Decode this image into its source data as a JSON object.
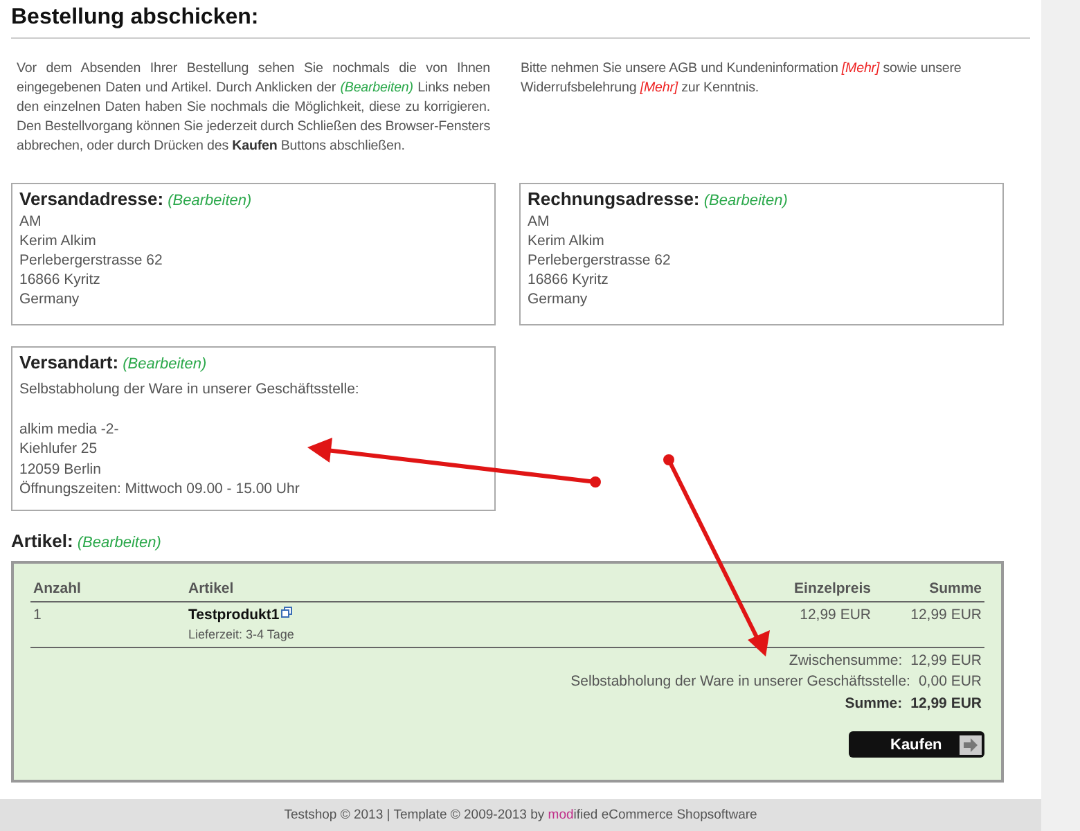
{
  "page_title": "Bestellung abschicken:",
  "intro": [
    {
      "kind": "text",
      "text": "Vor dem Absenden Ihrer Bestellung sehen Sie nochmals die von Ihnen eingegebenen Daten und Artikel. Durch Anklicken der "
    },
    {
      "kind": "link",
      "text": "(Bearbeiten)"
    },
    {
      "kind": "text",
      "text": " Links neben den einzelnen Daten haben Sie nochmals die Möglichkeit, diese zu korrigieren. Den Bestellvorgang können Sie jederzeit durch Schließen des Browser-Fensters abbrechen, oder durch Drücken des "
    },
    {
      "kind": "bold",
      "text": "Kaufen"
    },
    {
      "kind": "text",
      "text": " Buttons abschließen."
    }
  ],
  "terms": [
    {
      "kind": "text",
      "text": "Bitte nehmen Sie unsere AGB und Kundeninformation "
    },
    {
      "kind": "link",
      "text": "[Mehr]"
    },
    {
      "kind": "text",
      "text": " sowie unsere Widerrufsbelehrung "
    },
    {
      "kind": "link",
      "text": "[Mehr]"
    },
    {
      "kind": "text",
      "text": " zur Kenntnis."
    }
  ],
  "addresses": [
    {
      "heading": "Versandadresse:",
      "edit_link": "(Bearbeiten)",
      "lines": [
        "AM",
        "Kerim Alkim",
        "Perlebergerstrasse 62",
        "16866 Kyritz",
        "Germany"
      ]
    },
    {
      "heading": "Rechnungsadresse:",
      "edit_link": "(Bearbeiten)",
      "lines": [
        "AM",
        "Kerim Alkim",
        "Perlebergerstrasse 62",
        "16866 Kyritz",
        "Germany"
      ]
    }
  ],
  "shipping": {
    "heading": "Versandart:",
    "edit_link": "(Bearbeiten)",
    "method": "Selbstabholung der Ware in unserer Geschäftsstelle:",
    "lines": [
      "alkim media -2-",
      "Kiehlufer 25",
      "12059 Berlin",
      "Öffnungszeiten: Mittwoch 09.00 - 15.00 Uhr"
    ]
  },
  "articles": {
    "heading": "Artikel:",
    "edit_link": "(Bearbeiten)",
    "columns": [
      "Anzahl",
      "Artikel",
      "Einzelpreis",
      "Summe"
    ],
    "rows": [
      {
        "qty": "1",
        "name": "Testprodukt1",
        "delivery": "Lieferzeit: 3-4 Tage",
        "unit_price": "12,99 EUR",
        "total": "12,99 EUR"
      }
    ],
    "totals": [
      {
        "label": "Zwischensumme:",
        "value": "12,99 EUR",
        "bold": false
      },
      {
        "label": "Selbstabholung der Ware in unserer Geschäftsstelle:",
        "value": "0,00 EUR",
        "bold": false
      },
      {
        "label": "Summe:",
        "value": "12,99 EUR",
        "bold": true
      }
    ],
    "buy_button": "Kaufen"
  },
  "footer": {
    "text": "Testshop © 2013 | Template © 2009-2013 by ",
    "brand_accent": "mod",
    "brand_rest": "ified eCommerce Shopsoftware"
  }
}
